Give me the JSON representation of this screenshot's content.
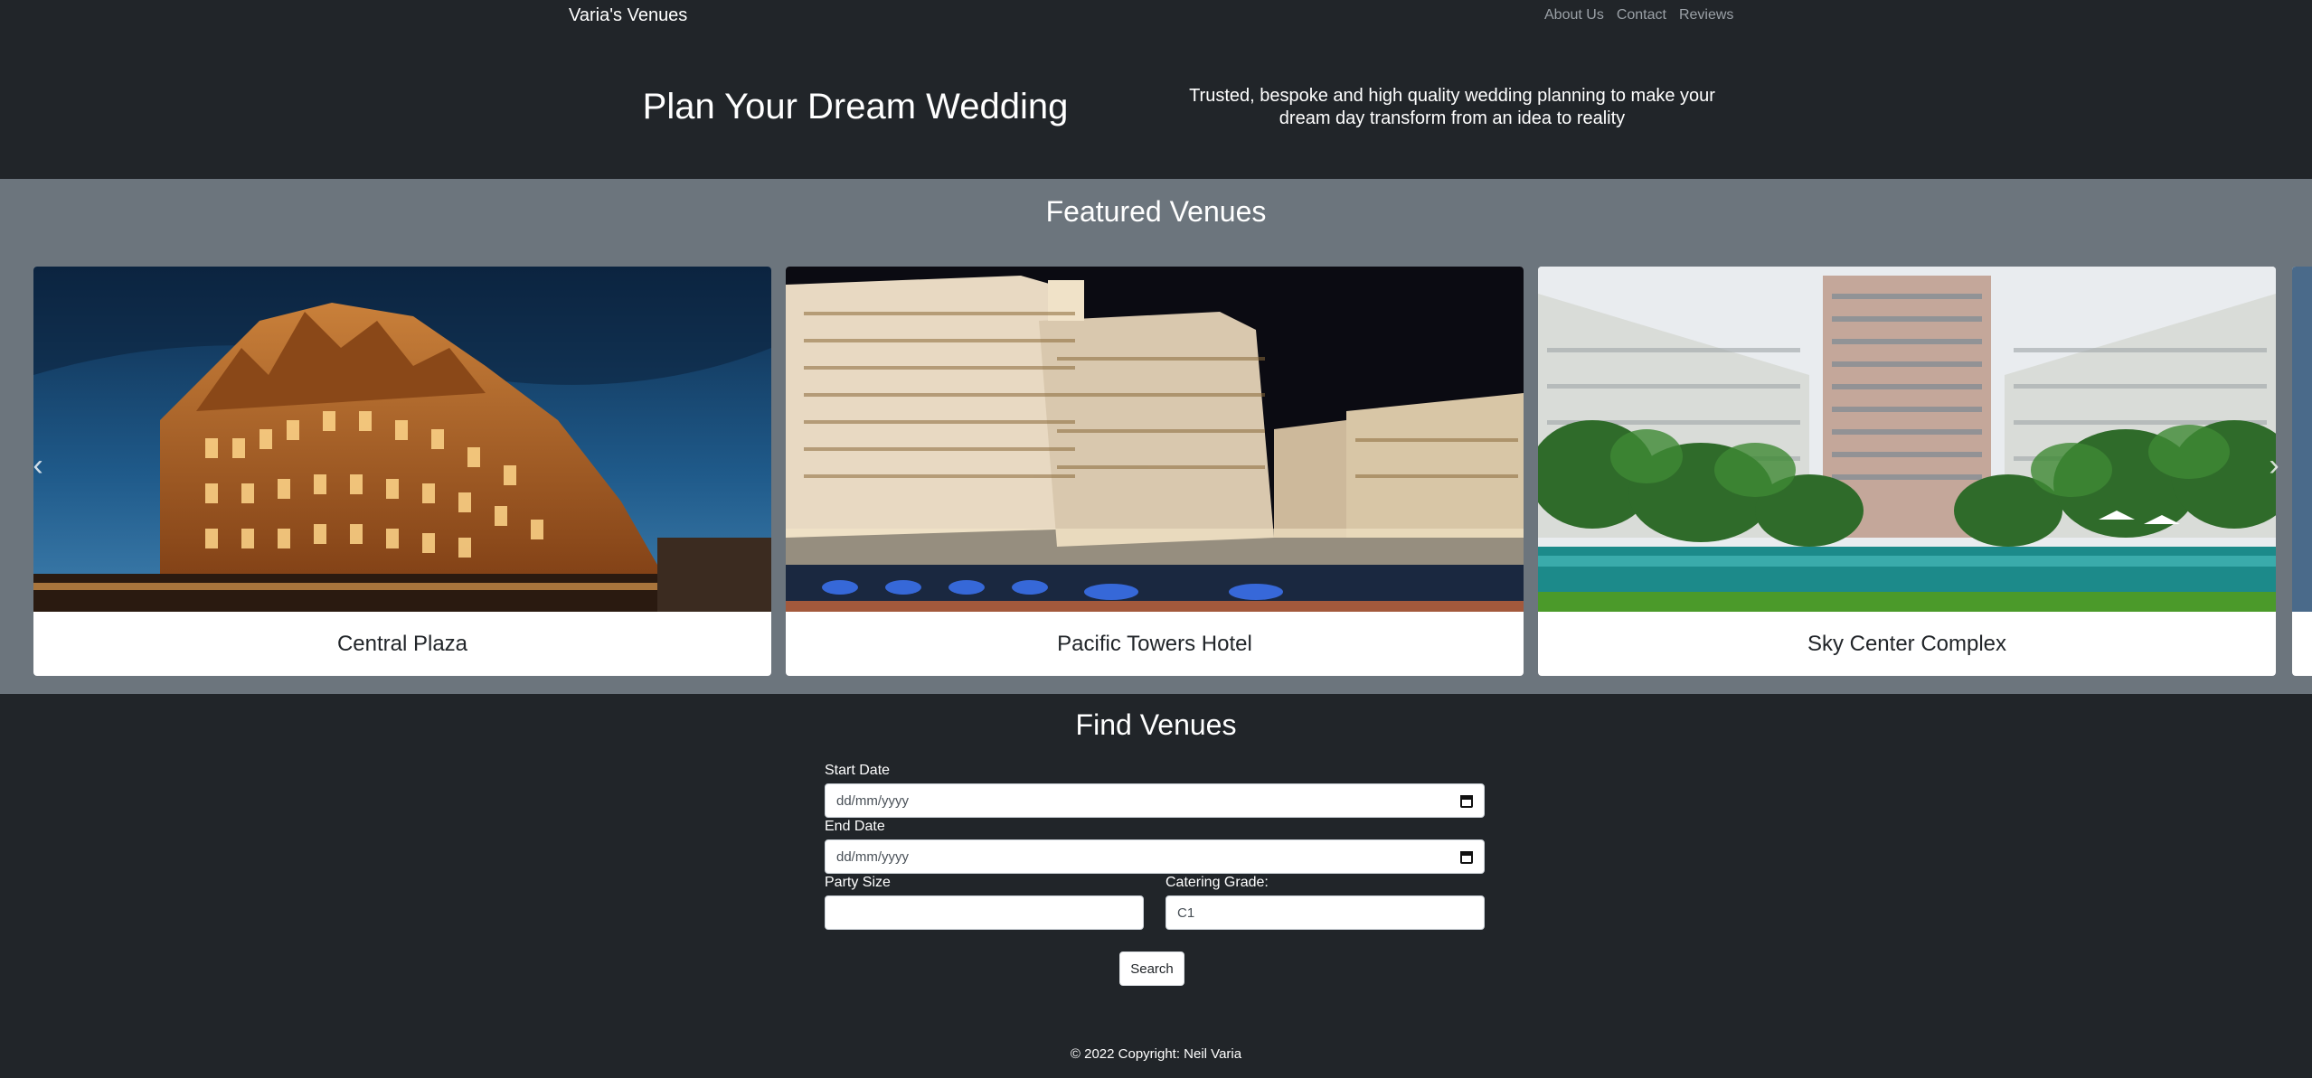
{
  "nav": {
    "brand": "Varia's Venues",
    "links": [
      "About Us",
      "Contact",
      "Reviews"
    ]
  },
  "hero": {
    "title": "Plan Your Dream Wedding",
    "tagline": "Trusted, bespoke and high quality wedding planning to make your dream day transform from an idea to reality"
  },
  "featured": {
    "title": "Featured Venues",
    "venues": [
      {
        "name": "Central Plaza"
      },
      {
        "name": "Pacific Towers Hotel"
      },
      {
        "name": "Sky Center Complex"
      }
    ],
    "prev_icon": "chevron-left-icon",
    "next_icon": "chevron-right-icon"
  },
  "search": {
    "title": "Find Venues",
    "start_label": "Start Date",
    "start_placeholder": "dd/mm/yyyy",
    "end_label": "End Date",
    "end_placeholder": "dd/mm/yyyy",
    "party_label": "Party Size",
    "party_value": "",
    "catering_label": "Catering Grade:",
    "catering_value": "C1",
    "button": "Search"
  },
  "footer": {
    "text": "© 2022 Copyright: Neil Varia"
  }
}
